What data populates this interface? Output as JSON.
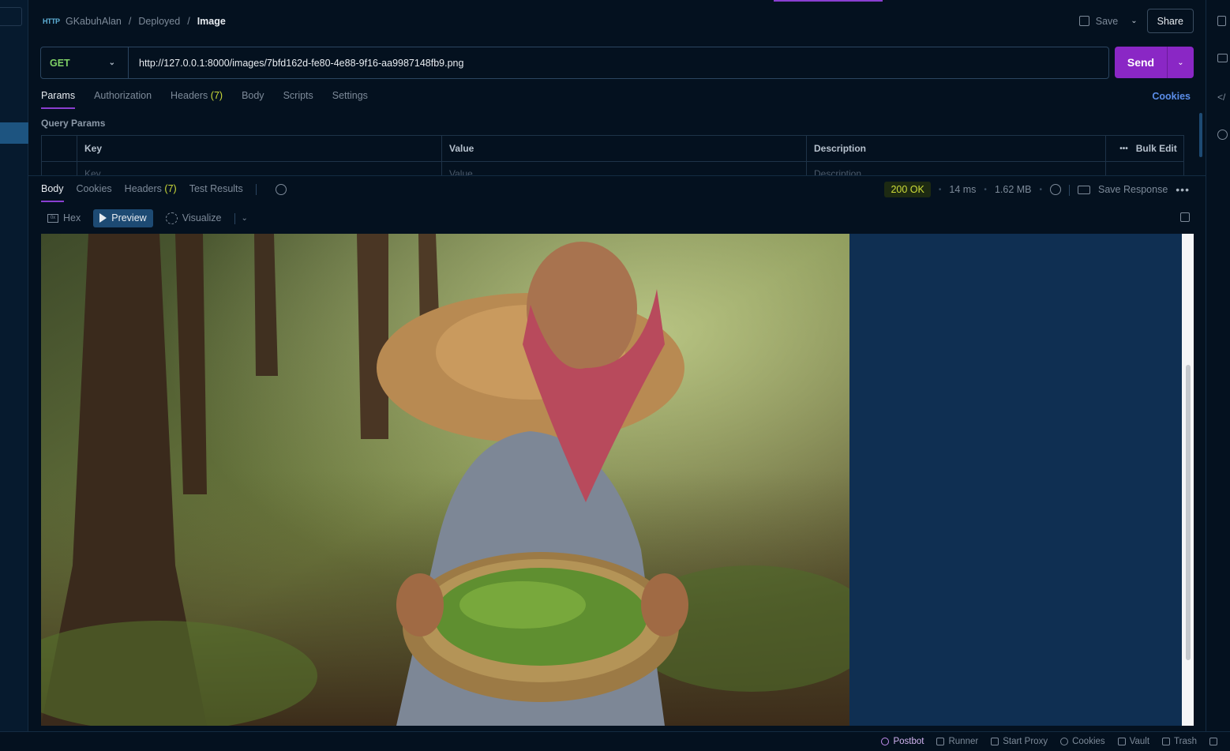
{
  "breadcrumb": {
    "protocol_icon_text": "HTTP",
    "workspace": "GKabuhAlan",
    "collection": "Deployed",
    "request": "Image",
    "separator": "/"
  },
  "toolbar": {
    "save_label": "Save",
    "share_label": "Share"
  },
  "request": {
    "method": "GET",
    "url": "http://127.0.0.1:8000/images/7bfd162d-fe80-4e88-9f16-aa9987148fb9.png",
    "send_label": "Send"
  },
  "request_tabs": {
    "params": "Params",
    "authorization": "Authorization",
    "headers": "Headers",
    "headers_count": "(7)",
    "body": "Body",
    "scripts": "Scripts",
    "settings": "Settings",
    "cookies": "Cookies"
  },
  "query_params": {
    "title": "Query Params",
    "columns": {
      "key": "Key",
      "value": "Value",
      "description": "Description"
    },
    "bulk_edit": "Bulk Edit",
    "placeholders": {
      "key": "Key",
      "value": "Value",
      "description": "Description"
    }
  },
  "response": {
    "tabs": {
      "body": "Body",
      "cookies": "Cookies",
      "headers": "Headers",
      "headers_count": "(7)",
      "test_results": "Test Results"
    },
    "status": "200 OK",
    "time": "14 ms",
    "size": "1.62 MB",
    "save_response": "Save Response",
    "view_modes": {
      "hex": "Hex",
      "preview": "Preview",
      "visualize": "Visualize"
    }
  },
  "status_bar": {
    "postbot": "Postbot",
    "runner": "Runner",
    "start_proxy": "Start Proxy",
    "cookies": "Cookies",
    "vault": "Vault",
    "trash": "Trash"
  },
  "colors": {
    "accent_purple": "#8a27c5",
    "method_get": "#7fd066",
    "status_ok": "#cddc39",
    "link_blue": "#5b8de8",
    "background": "#04111f"
  },
  "icons": [
    "http-icon",
    "save-icon",
    "chevron-down-icon",
    "history-icon",
    "globe-icon",
    "save-response-icon",
    "more-icon",
    "hex-icon",
    "play-icon",
    "visualize-icon",
    "copy-icon",
    "postbot-icon",
    "runner-icon",
    "proxy-icon",
    "cookie-icon",
    "vault-icon",
    "trash-icon"
  ]
}
